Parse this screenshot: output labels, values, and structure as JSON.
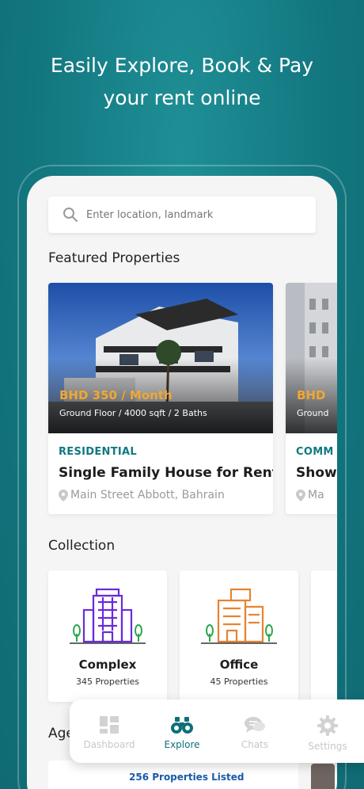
{
  "headline": {
    "line1": "Easily Explore, Book & Pay",
    "line2": "your rent online"
  },
  "search": {
    "placeholder": "Enter location, landmark"
  },
  "featured": {
    "title": "Featured Properties",
    "cards": [
      {
        "price": "BHD 350 / Month",
        "specs": "Ground Floor / 4000 sqft / 2 Baths",
        "type": "RESIDENTIAL",
        "title": "Single Family House for Rent",
        "location": "Main Street Abbott, Bahrain"
      },
      {
        "price": "BHD",
        "specs": "Ground",
        "type": "COMM",
        "title": "Show",
        "location": "Ma"
      }
    ]
  },
  "collection": {
    "title": "Collection",
    "items": [
      {
        "name": "Complex",
        "count": "345 Properties",
        "icon": "apartment-building-icon",
        "color": "#6b2bd9"
      },
      {
        "name": "Office",
        "count": "45 Properties",
        "icon": "office-building-icon",
        "color": "#e8832e"
      }
    ]
  },
  "agents": {
    "title": "Age",
    "count_label": "256 Properties Listed"
  },
  "tabbar": {
    "tabs": [
      {
        "label": "Dashboard",
        "icon": "dashboard-icon",
        "active": false
      },
      {
        "label": "Explore",
        "icon": "binoculars-icon",
        "active": true
      },
      {
        "label": "Chats",
        "icon": "chat-bubbles-icon",
        "active": false
      },
      {
        "label": "Settings",
        "icon": "gear-icon",
        "active": false
      }
    ]
  },
  "colors": {
    "background": "#137780",
    "accent": "#0f7a80",
    "price": "#f0a733",
    "purple_icon": "#6b2bd9",
    "orange_icon": "#e8832e"
  }
}
